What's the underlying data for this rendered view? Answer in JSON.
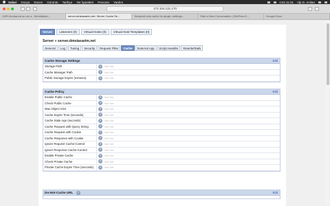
{
  "menubar": {
    "app": "Safari",
    "items": [
      "Dosya",
      "Düzen",
      "Görüntü",
      "Tarihçe",
      "Yer İşaretleri",
      "Pencere",
      "Yardım"
    ],
    "clock": "Cmt 11:31",
    "user": "Alp D. Arslan"
  },
  "browser": {
    "url": "172.104.131.170",
    "tabs": [
      {
        "label": "CMS Arzularına su cer a - Muhdaktan...",
        "active": false
      },
      {
        "label": "server.dmstasarim.net: Server Cache Se...",
        "active": true
      },
      {
        "label": "Yeepresti cms cache ile plugin: settings...",
        "active": false
      },
      {
        "label": "Start a New Conversation | WinPara G...",
        "active": false
      },
      {
        "label": "Google Docs",
        "active": false
      }
    ]
  },
  "page_tabs": [
    {
      "label": "Server",
      "active": true
    },
    {
      "label": "Listeners (0)",
      "active": false
    },
    {
      "label": "Virtual Hosts (0)",
      "active": false
    },
    {
      "label": "Virtual Host Templates (0)",
      "active": false
    }
  ],
  "breadcrumb": "Server » server.dmstasarim.net",
  "sub_tabs": [
    {
      "label": "General",
      "active": false
    },
    {
      "label": "Log",
      "active": false
    },
    {
      "label": "Tuning",
      "active": false
    },
    {
      "label": "Security",
      "active": false
    },
    {
      "label": "Request Filter",
      "active": false
    },
    {
      "label": "Cache",
      "active": true
    },
    {
      "label": "External App",
      "active": false
    },
    {
      "label": "Script Handler",
      "active": false
    },
    {
      "label": "Rewrite/Rails",
      "active": false
    }
  ],
  "panels": [
    {
      "title": "Cache Storage Settings",
      "edit": "Edit",
      "rows": [
        {
          "label": "Storage Path",
          "value": "Not Set"
        },
        {
          "label": "Cache Manager Path",
          "value": "Not Set"
        },
        {
          "label": "Public Storage Expire (minutes)",
          "value": "Not Set"
        }
      ]
    },
    {
      "title": "Cache Policy",
      "edit": "Edit",
      "rows": [
        {
          "label": "Enable Public Cache",
          "value": "Not Set"
        },
        {
          "label": "Check Public Cache",
          "value": "Not Set"
        },
        {
          "label": "Max Object Size",
          "value": "Not Set"
        },
        {
          "label": "Cache Expire Time (seconds)",
          "value": "Not Set"
        },
        {
          "label": "Cache Stale Age (seconds)",
          "value": "Not Set"
        },
        {
          "label": "Cache Request with Query String",
          "value": "Not Set"
        },
        {
          "label": "Cache Request with Cookie",
          "value": "Not Set"
        },
        {
          "label": "Cache Response with Cookie",
          "value": "Not Set"
        },
        {
          "label": "Ignore Request Cache-Control",
          "value": "Not Set"
        },
        {
          "label": "Ignore Response Cache-Control",
          "value": "Not Set"
        },
        {
          "label": "Enable Private Cache",
          "value": "Not Set"
        },
        {
          "label": "Check Private Cache",
          "value": "Not Set"
        },
        {
          "label": "Private Cache Expire Time (seconds)",
          "value": "Not Set"
        }
      ]
    },
    {
      "title": "Do-Not-Cache URL",
      "edit": "Edit",
      "rows": []
    }
  ],
  "colors": {
    "active_tab": "#6e8cc1",
    "panel_header": "#cad6ea",
    "edit_link": "#2f56a8"
  }
}
